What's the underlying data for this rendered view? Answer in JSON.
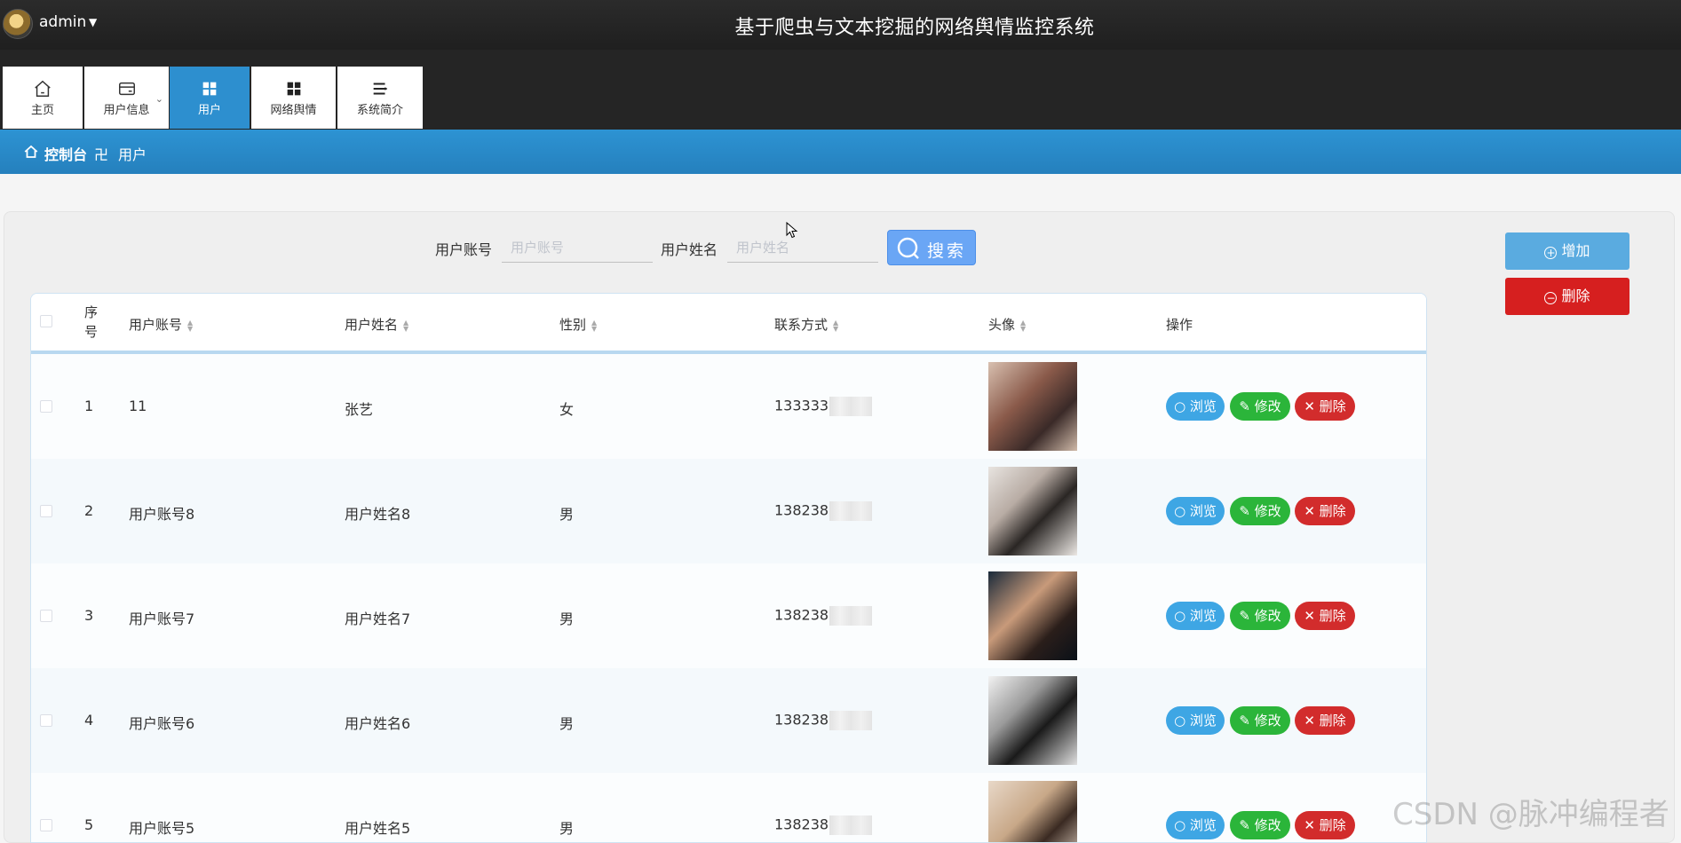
{
  "header": {
    "user": "admin",
    "title": "基于爬虫与文本挖掘的网络舆情监控系统"
  },
  "nav": [
    {
      "label": "主页",
      "icon": "home-icon"
    },
    {
      "label": "用户信息",
      "icon": "card-icon"
    },
    {
      "label": "用户",
      "icon": "grid-icon",
      "active": true
    },
    {
      "label": "网络舆情",
      "icon": "grid-icon"
    },
    {
      "label": "系统简介",
      "icon": "list-icon"
    }
  ],
  "breadcrumb": {
    "home": "控制台",
    "separator": "卍",
    "current": "用户"
  },
  "search": {
    "account_label": "用户账号",
    "account_placeholder": "用户账号",
    "name_label": "用户姓名",
    "name_placeholder": "用户姓名",
    "button": "搜索"
  },
  "side_buttons": {
    "add": "增加",
    "delete": "删除"
  },
  "table": {
    "columns": [
      "序号",
      "用户账号",
      "用户姓名",
      "性别",
      "联系方式",
      "头像",
      "操作"
    ],
    "rows": [
      {
        "idx": "1",
        "account": "11",
        "name": "张艺",
        "gender": "女",
        "phone": "133333"
      },
      {
        "idx": "2",
        "account": "用户账号8",
        "name": "用户姓名8",
        "gender": "男",
        "phone": "138238"
      },
      {
        "idx": "3",
        "account": "用户账号7",
        "name": "用户姓名7",
        "gender": "男",
        "phone": "138238"
      },
      {
        "idx": "4",
        "account": "用户账号6",
        "name": "用户姓名6",
        "gender": "男",
        "phone": "138238"
      },
      {
        "idx": "5",
        "account": "用户账号5",
        "name": "用户姓名5",
        "gender": "男",
        "phone": "138238"
      }
    ],
    "actions": {
      "view": "浏览",
      "edit": "修改",
      "delete": "删除"
    }
  },
  "watermark": "CSDN @脉冲编程者",
  "colors": {
    "accent": "#2d8fcf",
    "view": "#3ea6e4",
    "edit": "#2bb53a",
    "delete": "#d22c2c"
  }
}
